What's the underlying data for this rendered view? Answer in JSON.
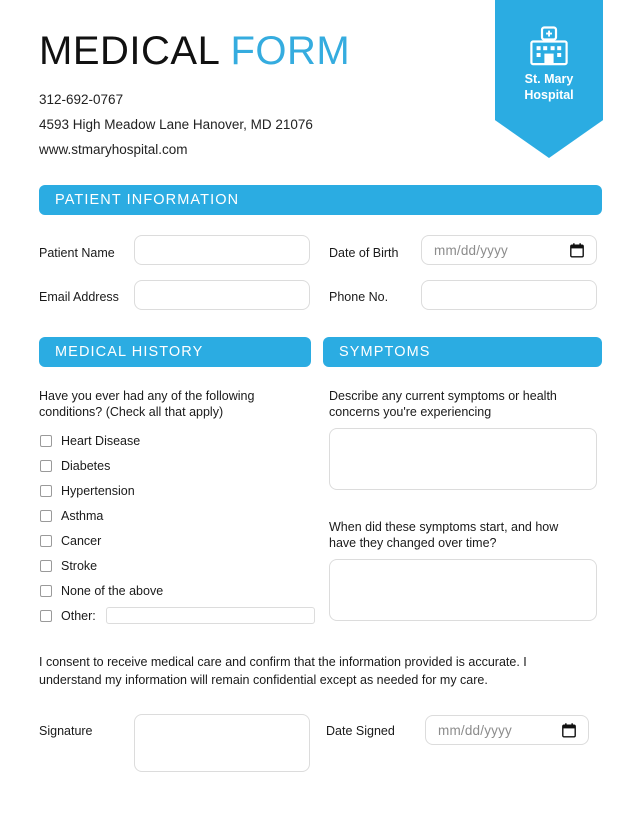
{
  "header": {
    "title_part1": "MEDICAL",
    "title_part2": "FORM",
    "phone": "312-692-0767",
    "address": "4593 High Meadow Lane Hanover, MD 21076",
    "website": "www.stmaryhospital.com",
    "logo": {
      "icon": "hospital-building-icon",
      "name_line1": "St. Mary",
      "name_line2": "Hospital"
    }
  },
  "colors": {
    "accent_blue": "#2BACE2",
    "title_blue": "#35ACDF",
    "border_gray": "#dcdcdc",
    "text_dark": "#1a1a1a",
    "placeholder_gray": "#8c8c8c"
  },
  "sections": {
    "patient_information": {
      "bar_label": "PATIENT INFORMATION",
      "fields": [
        {
          "label": "Patient Name",
          "value": "",
          "placeholder": "",
          "type": "text"
        },
        {
          "label": "Date of Birth",
          "value": "",
          "placeholder": "mm/dd/yyyy",
          "type": "date"
        },
        {
          "label": "Email Address",
          "value": "",
          "placeholder": "",
          "type": "text"
        },
        {
          "label": "Phone No.",
          "value": "",
          "placeholder": "",
          "type": "text"
        }
      ]
    },
    "medical_history": {
      "bar_label": "MEDICAL HISTORY",
      "question": "Have you ever had any of the following conditions? (Check all that apply)",
      "options": [
        {
          "label": "Heart Disease",
          "checked": false
        },
        {
          "label": "Diabetes",
          "checked": false
        },
        {
          "label": "Hypertension",
          "checked": false
        },
        {
          "label": "Asthma",
          "checked": false
        },
        {
          "label": "Cancer",
          "checked": false
        },
        {
          "label": "Stroke",
          "checked": false
        },
        {
          "label": "None of the above",
          "checked": false
        },
        {
          "label": "Other:",
          "checked": false,
          "has_input": true,
          "value": ""
        }
      ]
    },
    "symptoms": {
      "bar_label": "SYMPTOMS",
      "question1": "Describe any current symptoms or health concerns you're experiencing",
      "answer1": "",
      "question2": "When did these symptoms start, and how have they changed over time?",
      "answer2": ""
    },
    "consent": {
      "text": "I consent to receive medical care and confirm that the information provided is accurate. I understand my information will remain confidential except as needed for my care.",
      "signature_label": "Signature",
      "signature_value": "",
      "date_signed_label": "Date Signed",
      "date_signed_value": "",
      "date_signed_placeholder": "mm/dd/yyyy"
    }
  }
}
